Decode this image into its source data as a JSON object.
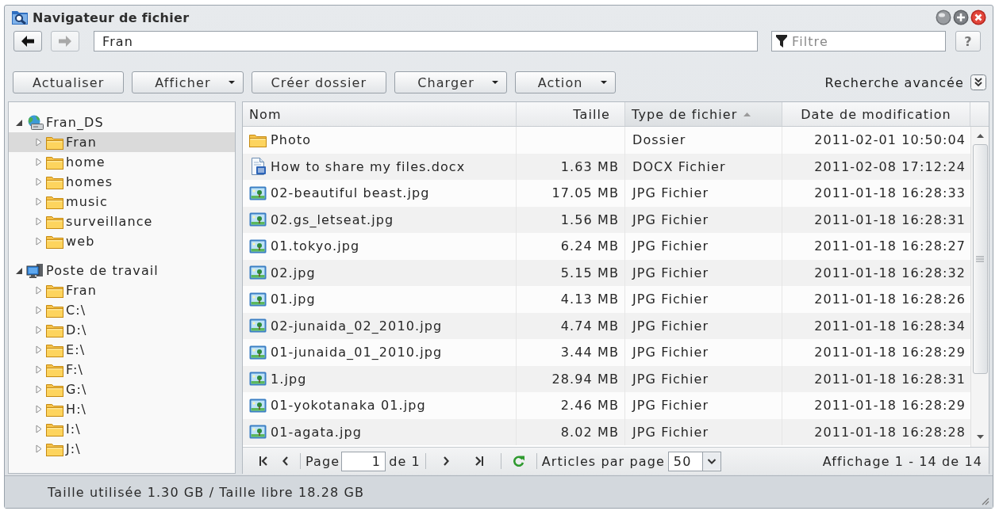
{
  "window": {
    "title": "Navigateur de fichier"
  },
  "navigation": {
    "back": {
      "disabled": false
    },
    "forward": {
      "disabled": true
    },
    "path": "Fran",
    "filter": {
      "placeholder": "Filtre"
    },
    "help": "?"
  },
  "toolbar": {
    "buttons": [
      {
        "label": "Actualiser",
        "kind": "button"
      },
      {
        "label": "Afficher",
        "kind": "menu"
      },
      {
        "label": "Créer dossier",
        "kind": "button"
      },
      {
        "label": "Charger",
        "kind": "menu"
      },
      {
        "label": "Action",
        "kind": "menu"
      }
    ],
    "advanced_search": "Recherche avancée"
  },
  "tree": [
    {
      "label": "Fran_DS",
      "kind": "server",
      "expanded": true,
      "selected": false,
      "children": [
        {
          "label": "Fran",
          "kind": "folder",
          "expanded": false,
          "selected": true
        },
        {
          "label": "home",
          "kind": "folder",
          "expanded": false,
          "selected": false
        },
        {
          "label": "homes",
          "kind": "folder",
          "expanded": false,
          "selected": false
        },
        {
          "label": "music",
          "kind": "folder",
          "expanded": false,
          "selected": false
        },
        {
          "label": "surveillance",
          "kind": "folder",
          "expanded": false,
          "selected": false
        },
        {
          "label": "web",
          "kind": "folder",
          "expanded": false,
          "selected": false
        }
      ]
    },
    {
      "label": "Poste de travail",
      "kind": "computer",
      "expanded": true,
      "selected": false,
      "children": [
        {
          "label": "Fran",
          "kind": "folder",
          "expanded": false,
          "selected": false
        },
        {
          "label": "C:\\",
          "kind": "folder",
          "expanded": false,
          "selected": false
        },
        {
          "label": "D:\\",
          "kind": "folder",
          "expanded": false,
          "selected": false
        },
        {
          "label": "E:\\",
          "kind": "folder",
          "expanded": false,
          "selected": false
        },
        {
          "label": "F:\\",
          "kind": "folder",
          "expanded": false,
          "selected": false
        },
        {
          "label": "G:\\",
          "kind": "folder",
          "expanded": false,
          "selected": false
        },
        {
          "label": "H:\\",
          "kind": "folder",
          "expanded": false,
          "selected": false
        },
        {
          "label": "I:\\",
          "kind": "folder",
          "expanded": false,
          "selected": false
        },
        {
          "label": "J:\\",
          "kind": "folder",
          "expanded": false,
          "selected": false
        }
      ]
    }
  ],
  "table": {
    "columns": [
      {
        "label": "Nom",
        "sorted": false
      },
      {
        "label": "Taille",
        "sorted": false
      },
      {
        "label": "Type de fichier",
        "sorted": true
      },
      {
        "label": "Date de modification",
        "sorted": false
      }
    ],
    "rows": [
      {
        "kind": "folder",
        "name": "Photo",
        "type": "Dossier",
        "date": "2011-02-01 10:50:04"
      },
      {
        "kind": "document",
        "name": "How to share my files.docx",
        "size": "1.63 MB",
        "type": "DOCX Fichier",
        "date": "2011-02-08 17:12:24"
      },
      {
        "kind": "image",
        "name": "02-beautiful beast.jpg",
        "size": "17.05 MB",
        "type": "JPG Fichier",
        "date": "2011-01-18 16:28:33"
      },
      {
        "kind": "image",
        "name": "02.gs_letseat.jpg",
        "size": "1.56 MB",
        "type": "JPG Fichier",
        "date": "2011-01-18 16:28:31"
      },
      {
        "kind": "image",
        "name": "01.tokyo.jpg",
        "size": "6.24 MB",
        "type": "JPG Fichier",
        "date": "2011-01-18 16:28:27"
      },
      {
        "kind": "image",
        "name": "02.jpg",
        "size": "5.15 MB",
        "type": "JPG Fichier",
        "date": "2011-01-18 16:28:32"
      },
      {
        "kind": "image",
        "name": "01.jpg",
        "size": "4.13 MB",
        "type": "JPG Fichier",
        "date": "2011-01-18 16:28:26"
      },
      {
        "kind": "image",
        "name": "02-junaida_02_2010.jpg",
        "size": "4.74 MB",
        "type": "JPG Fichier",
        "date": "2011-01-18 16:28:34"
      },
      {
        "kind": "image",
        "name": "01-junaida_01_2010.jpg",
        "size": "3.44 MB",
        "type": "JPG Fichier",
        "date": "2011-01-18 16:28:29"
      },
      {
        "kind": "image",
        "name": "1.jpg",
        "size": "28.94 MB",
        "type": "JPG Fichier",
        "date": "2011-01-18 16:28:31"
      },
      {
        "kind": "image",
        "name": "01-yokotanaka 01.jpg",
        "size": "2.46 MB",
        "type": "JPG Fichier",
        "date": "2011-01-18 16:28:29"
      },
      {
        "kind": "image",
        "name": "01-agata.jpg",
        "size": "8.02 MB",
        "type": "JPG Fichier",
        "date": "2011-01-18 16:28:28"
      }
    ]
  },
  "pager": {
    "page_label": "Page",
    "page": "1",
    "of_label": "de 1",
    "per_page_label": "Articles par page",
    "per_page": "50",
    "summary": "Affichage 1 - 14 de 14"
  },
  "status_bar": {
    "text": "Taille utilisée 1.30 GB / Taille libre 18.28 GB"
  }
}
